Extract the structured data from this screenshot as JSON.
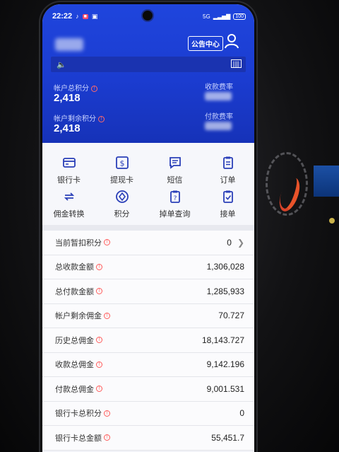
{
  "status_bar": {
    "time": "22:22",
    "network": "5G",
    "battery": "100"
  },
  "header": {
    "notice_center": "公告中心",
    "account_total_points_label": "帐户总积分",
    "account_total_points_value": "2,418",
    "account_remaining_points_label": "帐户剩余积分",
    "account_remaining_points_value": "2,418",
    "collection_rate_label": "收款费率",
    "payment_rate_label": "付款费率"
  },
  "menu": {
    "items": [
      {
        "label": "银行卡",
        "icon": "bank-card-icon"
      },
      {
        "label": "提现卡",
        "icon": "withdraw-card-icon"
      },
      {
        "label": "短信",
        "icon": "sms-icon"
      },
      {
        "label": "订单",
        "icon": "order-icon"
      },
      {
        "label": "佣金转换",
        "icon": "commission-convert-icon"
      },
      {
        "label": "积分",
        "icon": "points-icon"
      },
      {
        "label": "掉单查询",
        "icon": "lost-order-query-icon"
      },
      {
        "label": "接单",
        "icon": "accept-order-icon"
      }
    ]
  },
  "list": {
    "rows": [
      {
        "label": "当前暂扣积分",
        "value": "0"
      },
      {
        "label": "总收款金额",
        "value": "1,306,028"
      },
      {
        "label": "总付款金额",
        "value": "1,285,933"
      },
      {
        "label": "帐户剩余佣金",
        "value": "70.727"
      },
      {
        "label": "历史总佣金",
        "value": "18,143.727"
      },
      {
        "label": "收款总佣金",
        "value": "9,142.196"
      },
      {
        "label": "付款总佣金",
        "value": "9,001.531"
      },
      {
        "label": "银行卡总积分",
        "value": "0"
      },
      {
        "label": "银行卡总金额",
        "value": "55,451.7"
      }
    ]
  },
  "colors": {
    "header_blue": "#1f45dd",
    "info_red": "#ff5a5a"
  }
}
